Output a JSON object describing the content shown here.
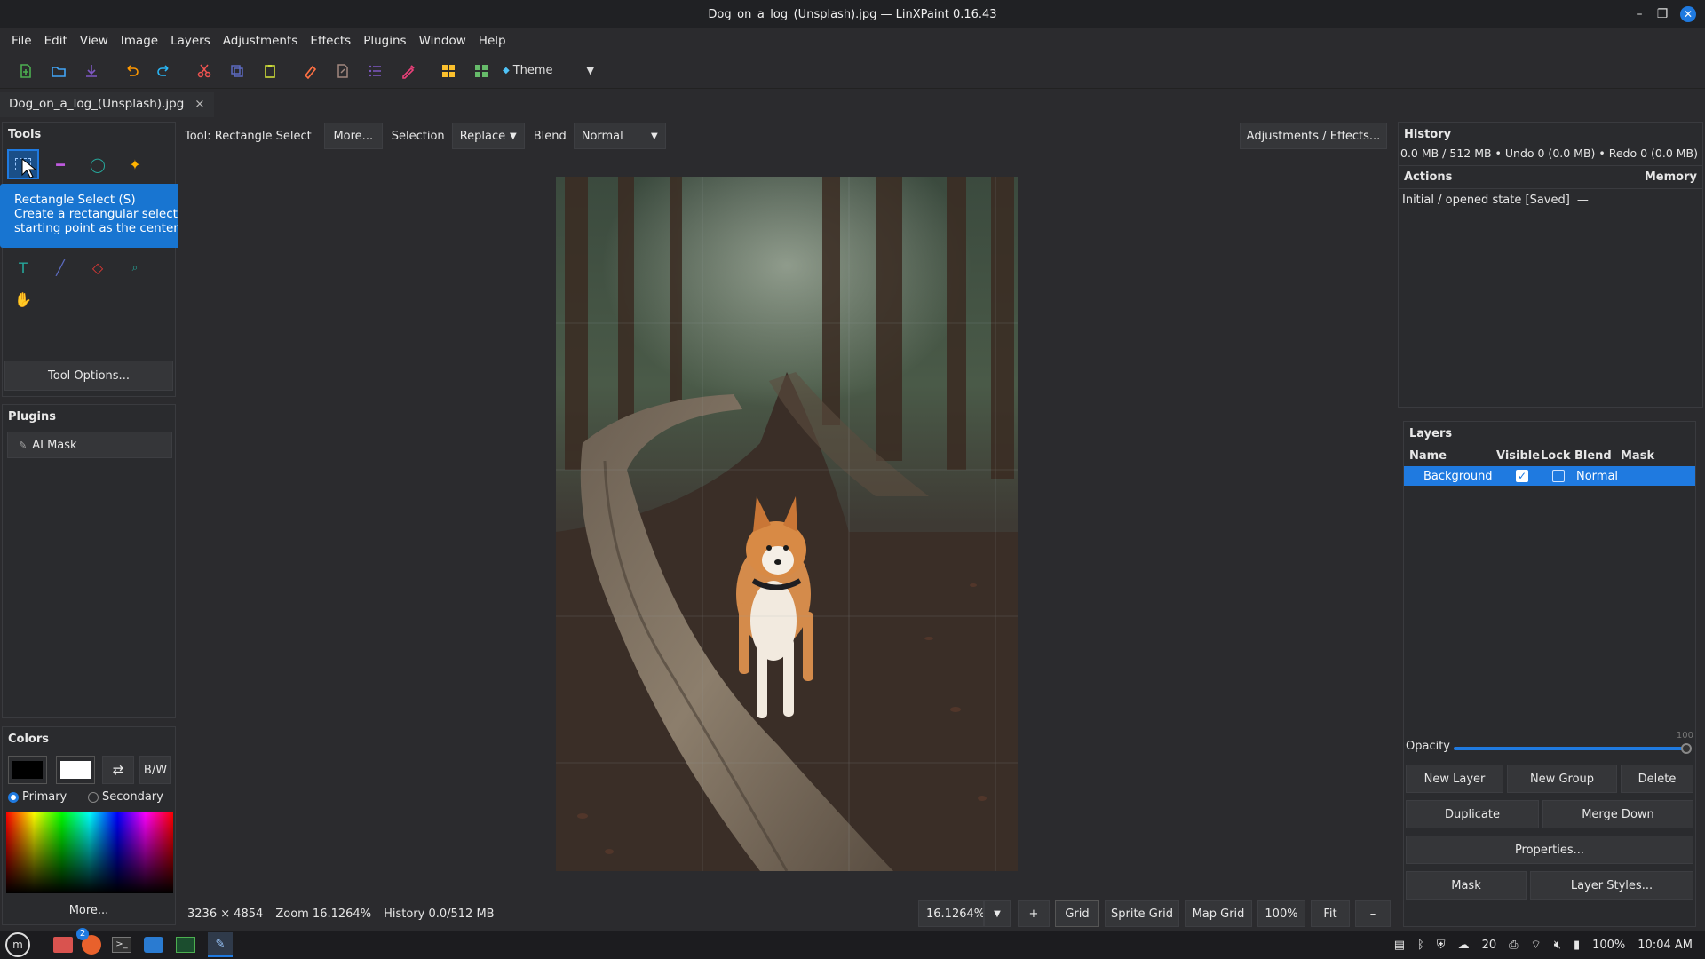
{
  "window": {
    "title": "Dog_on_a_log_(Unsplash).jpg — LinXPaint 0.16.43"
  },
  "menu": [
    "File",
    "Edit",
    "View",
    "Image",
    "Layers",
    "Adjustments",
    "Effects",
    "Plugins",
    "Window",
    "Help"
  ],
  "toolbar": {
    "theme_label": "Theme"
  },
  "doc_tab": {
    "label": "Dog_on_a_log_(Unsplash).jpg",
    "close": "×"
  },
  "tools_panel": {
    "title": "Tools",
    "tool_options_label": "Tool Options..."
  },
  "tooltip": {
    "title": "Rectangle Select (S)",
    "body": "Create a rectangular selection. Shift constrains to a square; Alt draws from the starting point as the center."
  },
  "plugins_panel": {
    "title": "Plugins",
    "items": [
      "AI Mask"
    ]
  },
  "colors_panel": {
    "title": "Colors",
    "swap_glyph": "⇄",
    "bw_label": "B/W",
    "primary_label": "Primary",
    "secondary_label": "Secondary",
    "more_label": "More...",
    "primary_color": "#000000",
    "secondary_color": "#ffffff"
  },
  "options_bar": {
    "tool_label": "Tool: Rectangle Select",
    "more_label": "More...",
    "selection_label": "Selection",
    "selection_mode": "Replace",
    "blend_label": "Blend",
    "blend_mode": "Normal",
    "adjustments_label": "Adjustments / Effects..."
  },
  "status_bar": {
    "dimensions": "3236 × 4854",
    "zoom": "Zoom 16.1264%",
    "history": "History 0.0/512 MB",
    "zoom_input": "16.1264%",
    "plus": "+",
    "grid": "Grid",
    "sprite_grid": "Sprite Grid",
    "map_grid": "Map Grid",
    "hundred": "100%",
    "fit": "Fit",
    "minus": "–"
  },
  "history_panel": {
    "title": "History",
    "memory_line": "0.0 MB / 512 MB  •  Undo 0 (0.0 MB)  •  Redo 0 (0.0 MB)",
    "col_actions": "Actions",
    "col_memory": "Memory",
    "rows": [
      {
        "action": "Initial / opened state  [Saved]",
        "memory": "—"
      }
    ]
  },
  "layers_panel": {
    "title": "Layers",
    "columns": [
      "Name",
      "Visible",
      "Lock",
      "Blend",
      "Mask"
    ],
    "rows": [
      {
        "name": "Background",
        "visible": true,
        "locked": false,
        "blend": "Normal",
        "mask": ""
      }
    ],
    "opacity_label": "Opacity",
    "opacity_value": "100",
    "opacity": 1.0,
    "buttons": {
      "new_layer": "New Layer",
      "new_group": "New Group",
      "delete": "Delete",
      "duplicate": "Duplicate",
      "merge_down": "Merge Down",
      "properties": "Properties...",
      "mask": "Mask",
      "layer_styles": "Layer Styles..."
    }
  },
  "taskbar": {
    "workspace_badge": "2",
    "temperature": "20",
    "battery": "100%",
    "clock": "10:04 AM"
  }
}
